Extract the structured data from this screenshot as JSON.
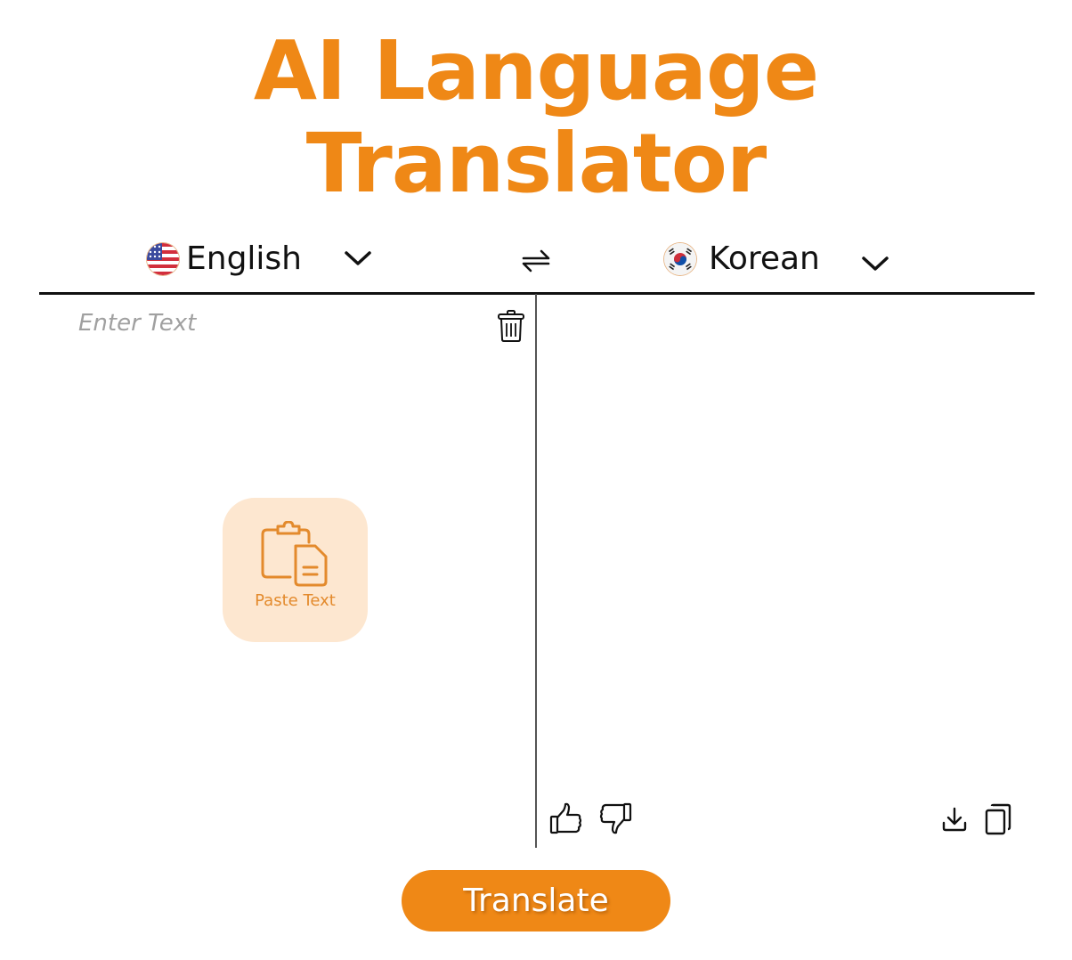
{
  "header": {
    "title_line1": "AI Language",
    "title_line2": "Translator"
  },
  "source_language": {
    "name": "English",
    "flag": "us-flag-icon"
  },
  "target_language": {
    "name": "Korean",
    "flag": "kr-flag-icon"
  },
  "source_panel": {
    "placeholder": "Enter Text",
    "value": "",
    "paste_label": "Paste Text"
  },
  "target_panel": {
    "value": ""
  },
  "icons": {
    "swap": "swap-icon",
    "clear": "trash-icon",
    "like": "thumbs-up-icon",
    "dislike": "thumbs-down-icon",
    "download": "download-icon",
    "copy": "copy-icon"
  },
  "actions": {
    "translate_label": "Translate"
  },
  "colors": {
    "accent": "#ef8816",
    "paste_bg": "#fde7d0",
    "placeholder": "#a0a0a0"
  }
}
